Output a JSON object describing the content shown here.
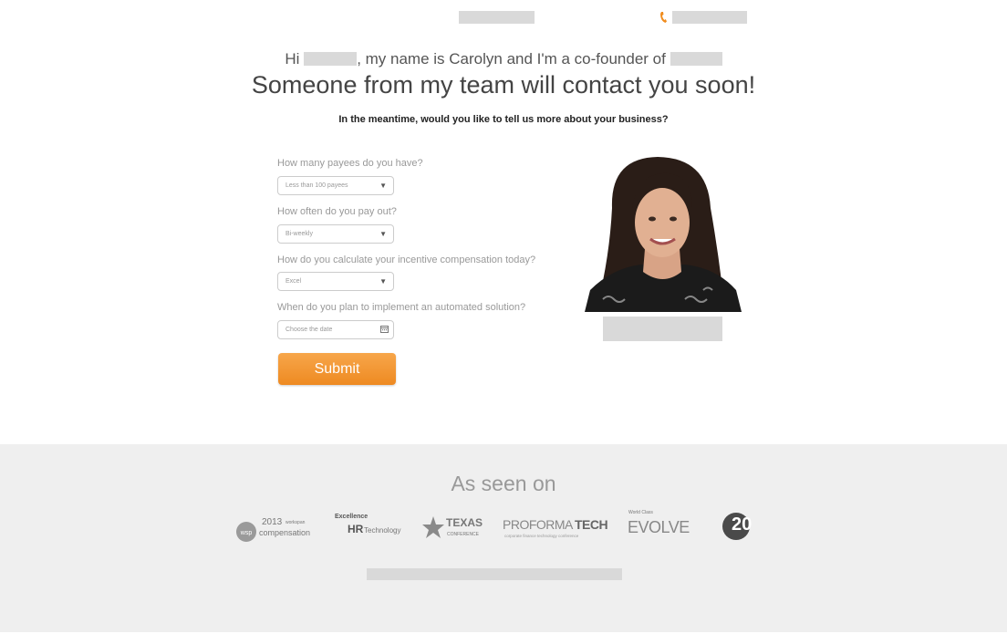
{
  "header": {
    "phone_icon": "phone-icon",
    "accent_color": "#f08c1e"
  },
  "greeting": {
    "hi": "Hi",
    "middle": ", my name is Carolyn and I'm a co-founder of",
    "headline": "Someone from my team will contact you soon!",
    "subhead": "In the meantime, would you like to tell us more about your business?"
  },
  "form": {
    "q1_label": "How many payees do you have?",
    "q1_value": "Less than 100 payees",
    "q2_label": "How often do you pay out?",
    "q2_value": "Bi-weekly",
    "q3_label": "How do you calculate your incentive compensation today?",
    "q3_value": "Excel",
    "q4_label": "When do you plan to implement an automated solution?",
    "q4_placeholder": "Choose the date",
    "submit_label": "Submit"
  },
  "footer": {
    "title": "As seen on",
    "logos": {
      "l1_year": "2013",
      "l1_small": "workspan",
      "l1_text": "compensation",
      "l2_top": "Excellence",
      "l2_mid": "HR",
      "l2_bottom": "Technology",
      "l3_name": "TEXAS",
      "l3_sub": "CONFERENCE",
      "l4_name_a": "PROFORMA",
      "l4_name_b": "TECH",
      "l4_sub": "corporate finance technology conference",
      "l5_top": "World Class",
      "l5_name": "EVOLVE",
      "l6_text": "20"
    }
  }
}
